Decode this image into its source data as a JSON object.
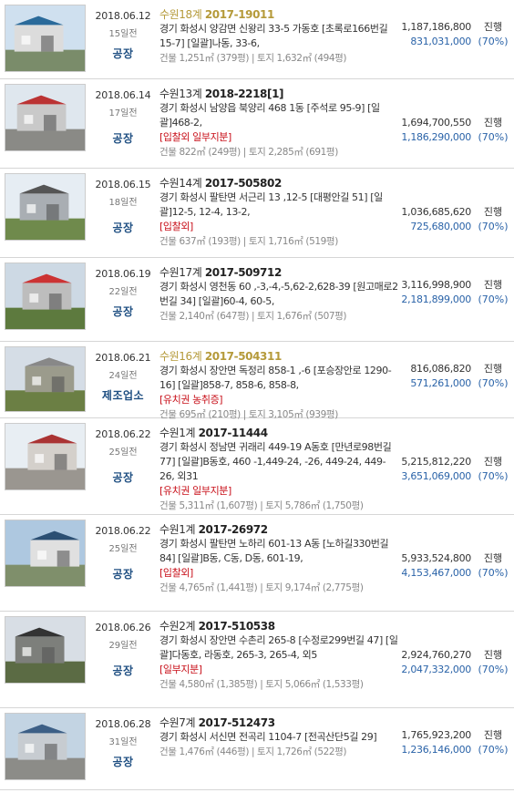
{
  "rows": [
    {
      "date": "2018.06.12",
      "dday": "15일전",
      "usage": "공장",
      "court": "수원18계",
      "case_no": "2017-19011",
      "highlight": true,
      "address": "경기 화성시 양감면 신왕리 33-5 가동호 [초록로166번길 15-7] [일괄]나동, 33-6,",
      "tags": "",
      "area": "건물 1,251㎡ (379평) | 토지 1,632㎡ (494평)",
      "appraisal": "1,187,186,800",
      "min_bid": "831,031,000",
      "status": "진행",
      "pct": "(70%)"
    },
    {
      "date": "2018.06.14",
      "dday": "17일전",
      "usage": "공장",
      "court": "수원13계",
      "case_no": "2018-2218[1]",
      "highlight": false,
      "address": "경기 화성시 남양읍 북양리 468 1동 [주석로 95-9] [일괄]468-2,",
      "tags": "[입찰외  일부지분]",
      "area": "건물 822㎡ (249평) | 토지 2,285㎡ (691평)",
      "appraisal": "1,694,700,550",
      "min_bid": "1,186,290,000",
      "status": "진행",
      "pct": "(70%)"
    },
    {
      "date": "2018.06.15",
      "dday": "18일전",
      "usage": "공장",
      "court": "수원14계",
      "case_no": "2017-505802",
      "highlight": false,
      "address": "경기 화성시 팔탄면 서근리 13 ,12-5 [대평안길 51] [일괄]12-5, 12-4, 13-2,",
      "tags": "[입찰외]",
      "area": "건물 637㎡ (193평) | 토지 1,716㎡ (519평)",
      "appraisal": "1,036,685,620",
      "min_bid": "725,680,000",
      "status": "진행",
      "pct": "(70%)"
    },
    {
      "date": "2018.06.19",
      "dday": "22일전",
      "usage": "공장",
      "court": "수원17계",
      "case_no": "2017-509712",
      "highlight": false,
      "address": "경기 화성시 영천동 60 ,-3,-4,-5,62-2,628-39 [원고매로2번길 34] [일괄]60-4, 60-5,",
      "tags": "",
      "area": "건물 2,140㎡ (647평) | 토지 1,676㎡ (507평)",
      "appraisal": "3,116,998,900",
      "min_bid": "2,181,899,000",
      "status": "진행",
      "pct": "(70%)"
    },
    {
      "date": "2018.06.21",
      "dday": "24일전",
      "usage": "제조업소",
      "court": "수원16계",
      "case_no": "2017-504311",
      "highlight": true,
      "address": "경기 화성시 장안면 독정리 858-1 ,-6 [포승장안로 1290-16] [일괄]858-7, 858-6, 858-8,",
      "tags": "[유치권  농취증]",
      "area": "건물 695㎡ (210평) | 토지 3,105㎡ (939평)",
      "appraisal": "816,086,820",
      "min_bid": "571,261,000",
      "status": "진행",
      "pct": "(70%)"
    },
    {
      "date": "2018.06.22",
      "dday": "25일전",
      "usage": "공장",
      "court": "수원1계",
      "case_no": "2017-11444",
      "highlight": false,
      "address": "경기 화성시 정남면 귀래리 449-19 A동호 [만년로98번길 77] [일괄]B동호, 460 -1,449-24, -26, 449-24, 449-26, 외31",
      "tags": "[유치권  일부지분]",
      "area": "건물 5,311㎡ (1,607평) | 토지 5,786㎡ (1,750평)",
      "appraisal": "5,215,812,220",
      "min_bid": "3,651,069,000",
      "status": "진행",
      "pct": "(70%)"
    },
    {
      "date": "2018.06.22",
      "dday": "25일전",
      "usage": "공장",
      "court": "수원1계",
      "case_no": "2017-26972",
      "highlight": false,
      "address": "경기 화성시 팔탄면 노하리 601-13 A동 [노하길330번길 84] [일괄]B동, C동, D동, 601-19,",
      "tags": "[입찰외]",
      "area": "건물 4,765㎡ (1,441평) | 토지 9,174㎡ (2,775평)",
      "appraisal": "5,933,524,800",
      "min_bid": "4,153,467,000",
      "status": "진행",
      "pct": "(70%)"
    },
    {
      "date": "2018.06.26",
      "dday": "29일전",
      "usage": "공장",
      "court": "수원2계",
      "case_no": "2017-510538",
      "highlight": false,
      "address": "경기 화성시 장안면 수촌리 265-8 [수정로299번길 47] [일괄]다동호, 라동호, 265-3, 265-4, 외5",
      "tags": "[일부지분]",
      "area": "건물 4,580㎡ (1,385평) | 토지 5,066㎡ (1,533평)",
      "appraisal": "2,924,760,270",
      "min_bid": "2,047,332,000",
      "status": "진행",
      "pct": "(70%)"
    },
    {
      "date": "2018.06.28",
      "dday": "31일전",
      "usage": "공장",
      "court": "수원7계",
      "case_no": "2017-512473",
      "highlight": false,
      "address": "경기 화성시 서신면 전곡리 1104-7 [전곡산단5길 29]",
      "tags": "",
      "area": "건물 1,476㎡ (446평) | 토지 1,726㎡ (522평)",
      "appraisal": "1,765,923,200",
      "min_bid": "1,236,146,000",
      "status": "진행",
      "pct": "(70%)"
    }
  ]
}
